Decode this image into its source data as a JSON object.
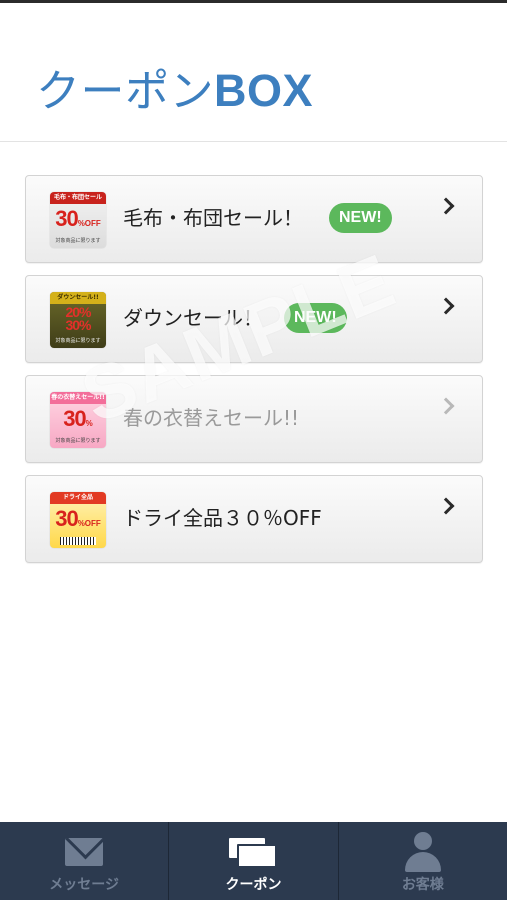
{
  "header": {
    "title": "クーポン",
    "title_suffix": "BOX",
    "accent_color": "#3d7fbf"
  },
  "coupons": [
    {
      "title": "毛布・布団セール！",
      "new_badge": "NEW!",
      "thumb": {
        "top": "毛布・布団セール",
        "main": "30",
        "unit": "%OFF",
        "bottom": "対象商品に限ります"
      }
    },
    {
      "title": "ダウンセール！",
      "new_badge": "NEW!",
      "thumb": {
        "top": "ダウンセール!!",
        "main": "20%",
        "unit": "30%",
        "bottom": "対象商品に限ります"
      }
    },
    {
      "title": "春の衣替えセール!!",
      "thumb": {
        "top": "春の衣替えセール!!",
        "main": "30",
        "unit": "%",
        "bottom": "対象商品に限ります"
      }
    },
    {
      "title": "ドライ全品３０％OFF",
      "thumb": {
        "top": "ドライ全品",
        "main": "30",
        "unit": "%OFF"
      }
    }
  ],
  "watermark": "SAMPLE",
  "tabbar": {
    "items": [
      {
        "label": "メッセージ",
        "icon": "mail-icon"
      },
      {
        "label": "クーポン",
        "icon": "coupons-icon",
        "active": true
      },
      {
        "label": "お客様",
        "icon": "person-icon"
      }
    ],
    "background": "#2c3a4f"
  },
  "badge_color": "#5cb85c"
}
